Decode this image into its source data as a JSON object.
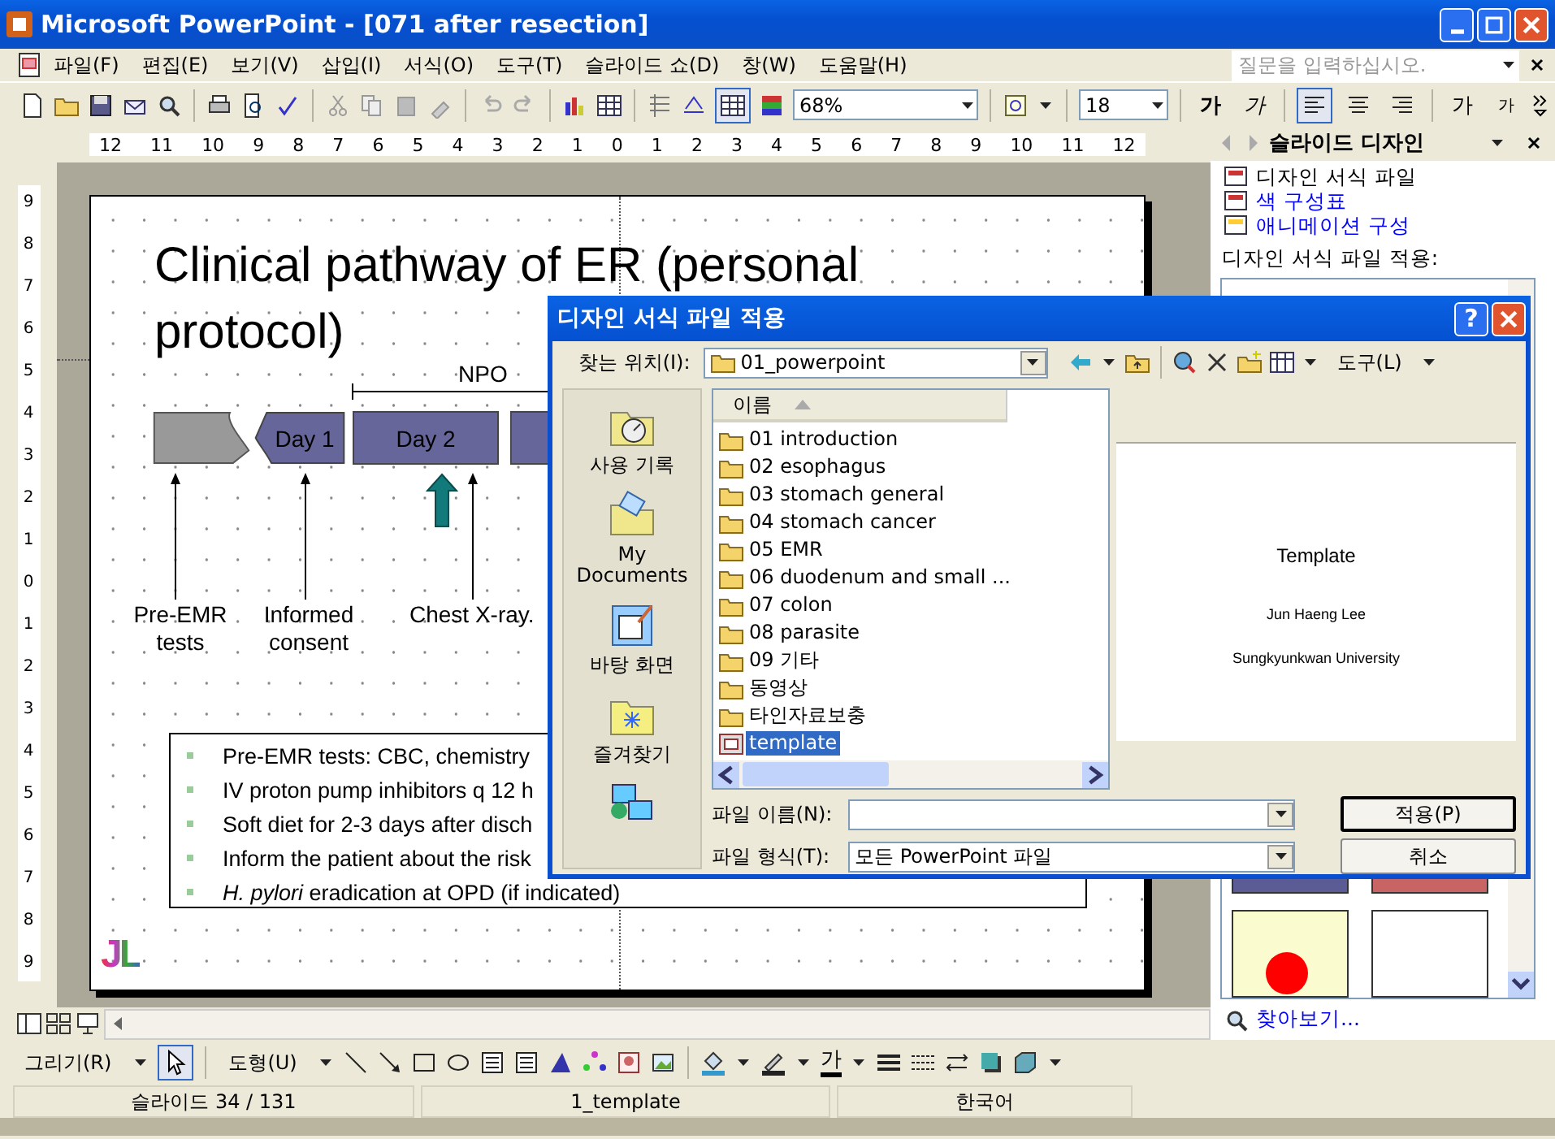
{
  "window": {
    "title": "Microsoft PowerPoint - [071 after resection]"
  },
  "menu": [
    "파일(F)",
    "편집(E)",
    "보기(V)",
    "삽입(I)",
    "서식(O)",
    "도구(T)",
    "슬라이드 쇼(D)",
    "창(W)",
    "도움말(H)"
  ],
  "help_box": {
    "placeholder": "질문을 입력하십시오."
  },
  "toolbar": {
    "show_grid": true,
    "zoom": "68%",
    "font_size": "18",
    "format_buttons": [
      {
        "kind": "bold",
        "label": "가"
      },
      {
        "kind": "italic",
        "label": "가"
      }
    ],
    "alignment_buttons": [
      {
        "kind": "left",
        "selected": true
      },
      {
        "kind": "center",
        "selected": false
      },
      {
        "kind": "right",
        "selected": false
      }
    ],
    "font_size_buttons": [
      {
        "kind": "grow",
        "label": "가"
      },
      {
        "kind": "shrink",
        "label": "가"
      }
    ]
  },
  "horizontal_ruler": [
    "12",
    "11",
    "10",
    "9",
    "8",
    "7",
    "6",
    "5",
    "4",
    "3",
    "2",
    "1",
    "0",
    "1",
    "2",
    "3",
    "4",
    "5",
    "6",
    "7",
    "8",
    "9",
    "10",
    "11",
    "12"
  ],
  "vertical_ruler": [
    "9",
    "8",
    "7",
    "6",
    "5",
    "4",
    "3",
    "2",
    "1",
    "0",
    "1",
    "2",
    "3",
    "4",
    "5",
    "6",
    "7",
    "8",
    "9"
  ],
  "slide": {
    "title_lines": [
      "Clinical pathway of ER (personal",
      "protocol)"
    ],
    "span_label": "NPO",
    "steps": [
      {
        "kind": "gray"
      },
      {
        "kind": "wavy",
        "label": "Day 1"
      },
      {
        "kind": "box",
        "label": "Day 2"
      },
      {
        "kind": "box"
      }
    ],
    "callouts": [
      "Pre-EMR tests",
      "Informed consent",
      "Chest X-ray."
    ],
    "bullets": [
      "Pre-EMR tests: CBC, chemistry",
      "IV proton pump inhibitors q 12 h",
      "Soft diet for 2-3 days after disch",
      "Inform the patient about the risk",
      "*H. pylori* eradication at OPD (if indicated)"
    ],
    "logo": "JL"
  },
  "task_pane": {
    "title": "슬라이드 디자인",
    "links": [
      {
        "label": "디자인 서식 파일",
        "selected": true
      },
      {
        "label": "색 구성표",
        "selected": false
      },
      {
        "label": "애니메이션 구성",
        "selected": false
      }
    ],
    "section_label": "디자인 서식 파일 적용:",
    "browse_link": "찾아보기..."
  },
  "dialog": {
    "title": "디자인 서식 파일 적용",
    "help_button": "?",
    "look_in_label": "찾는 위치(I):",
    "look_in_value": "01_powerpoint",
    "tools_menu": "도구(L)",
    "places": [
      "사용 기록",
      "My Documents",
      "바탕 화면",
      "즐겨찾기"
    ],
    "column_header": "이름",
    "files": [
      {
        "name": "01 introduction",
        "kind": "folder",
        "selected": false
      },
      {
        "name": "02 esophagus",
        "kind": "folder",
        "selected": false
      },
      {
        "name": "03 stomach general",
        "kind": "folder",
        "selected": false
      },
      {
        "name": "04 stomach cancer",
        "kind": "folder",
        "selected": false
      },
      {
        "name": "05 EMR",
        "kind": "folder",
        "selected": false
      },
      {
        "name": "06 duodenum and small ...",
        "kind": "folder",
        "selected": false
      },
      {
        "name": "07 colon",
        "kind": "folder",
        "selected": false
      },
      {
        "name": "08 parasite",
        "kind": "folder",
        "selected": false
      },
      {
        "name": "09 기타",
        "kind": "folder",
        "selected": false
      },
      {
        "name": "동영상",
        "kind": "folder",
        "selected": false
      },
      {
        "name": "타인자료보충",
        "kind": "folder",
        "selected": false
      },
      {
        "name": "template",
        "kind": "presentation",
        "selected": true
      }
    ],
    "preview": [
      "Template",
      "Jun Haeng Lee",
      "Sungkyunkwan University"
    ],
    "file_name_label": "파일 이름(N):",
    "file_type_label": "파일 형식(T):",
    "file_type_value": "모든 PowerPoint 파일",
    "apply_button": "적용(P)",
    "cancel_button": "취소"
  },
  "drawing_toolbar": {
    "draw_menu": "그리기(R)",
    "shapes_menu": "도형(U)",
    "font_color_label": "가"
  },
  "status_bar": [
    "슬라이드 34 / 131",
    "1_template",
    "한국어"
  ]
}
